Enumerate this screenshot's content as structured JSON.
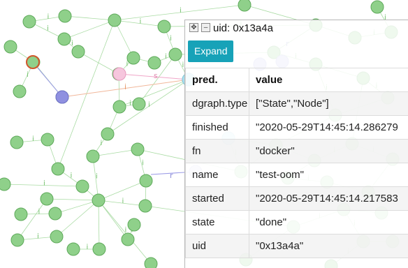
{
  "graph": {
    "node_fill": "#8fd08a",
    "node_stroke": "#5ea95a",
    "edge_color": "#a9dba3",
    "edge_label_color": "#6fbf68",
    "highlight_node_stroke": "#d0572b",
    "pink_node_fill": "#f6c6dd",
    "purple_node_fill": "#8f90e0",
    "edge_labels": [
      "i",
      "s",
      "r"
    ]
  },
  "panel": {
    "title": "uid: 0x13a4a",
    "move_icon": "move-arrows-icon",
    "minimize_icon": "minimize-icon",
    "expand_label": "Expand",
    "accent": "#17a2b8",
    "header": {
      "pred": "pred.",
      "value": "value"
    },
    "rows": [
      {
        "pred": "dgraph.type",
        "value": "[\"State\",\"Node\"]"
      },
      {
        "pred": "finished",
        "value": "\"2020-05-29T14:45:14.286279"
      },
      {
        "pred": "fn",
        "value": "\"docker\""
      },
      {
        "pred": "name",
        "value": "\"test-oom\""
      },
      {
        "pred": "started",
        "value": "\"2020-05-29T14:45:14.217583"
      },
      {
        "pred": "state",
        "value": "\"done\""
      },
      {
        "pred": "uid",
        "value": "\"0x13a4a\""
      }
    ]
  }
}
